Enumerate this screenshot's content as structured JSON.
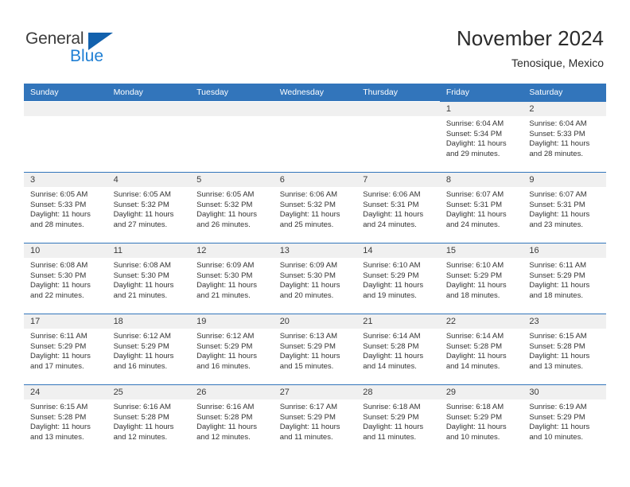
{
  "logo": {
    "word_top": "General",
    "word_bottom": "Blue",
    "triangle_color": "#1261ad",
    "blue_color": "#1f7fd4"
  },
  "header": {
    "title": "November 2024",
    "subtitle": "Tenosique, Mexico"
  },
  "theme": {
    "header_blue": "#3275bb",
    "daynum_gray": "#f0f0f0",
    "text": "#333333"
  },
  "weekdays": [
    "Sunday",
    "Monday",
    "Tuesday",
    "Wednesday",
    "Thursday",
    "Friday",
    "Saturday"
  ],
  "labels": {
    "sunrise_prefix": "Sunrise:",
    "sunset_prefix": "Sunset:",
    "daylight_prefix": "Daylight:"
  },
  "weeks": [
    [
      {
        "day": "",
        "sunrise": "",
        "sunset": "",
        "daylight1": "",
        "daylight2": ""
      },
      {
        "day": "",
        "sunrise": "",
        "sunset": "",
        "daylight1": "",
        "daylight2": ""
      },
      {
        "day": "",
        "sunrise": "",
        "sunset": "",
        "daylight1": "",
        "daylight2": ""
      },
      {
        "day": "",
        "sunrise": "",
        "sunset": "",
        "daylight1": "",
        "daylight2": ""
      },
      {
        "day": "",
        "sunrise": "",
        "sunset": "",
        "daylight1": "",
        "daylight2": ""
      },
      {
        "day": "1",
        "sunrise": "Sunrise: 6:04 AM",
        "sunset": "Sunset: 5:34 PM",
        "daylight1": "Daylight: 11 hours",
        "daylight2": "and 29 minutes."
      },
      {
        "day": "2",
        "sunrise": "Sunrise: 6:04 AM",
        "sunset": "Sunset: 5:33 PM",
        "daylight1": "Daylight: 11 hours",
        "daylight2": "and 28 minutes."
      }
    ],
    [
      {
        "day": "3",
        "sunrise": "Sunrise: 6:05 AM",
        "sunset": "Sunset: 5:33 PM",
        "daylight1": "Daylight: 11 hours",
        "daylight2": "and 28 minutes."
      },
      {
        "day": "4",
        "sunrise": "Sunrise: 6:05 AM",
        "sunset": "Sunset: 5:32 PM",
        "daylight1": "Daylight: 11 hours",
        "daylight2": "and 27 minutes."
      },
      {
        "day": "5",
        "sunrise": "Sunrise: 6:05 AM",
        "sunset": "Sunset: 5:32 PM",
        "daylight1": "Daylight: 11 hours",
        "daylight2": "and 26 minutes."
      },
      {
        "day": "6",
        "sunrise": "Sunrise: 6:06 AM",
        "sunset": "Sunset: 5:32 PM",
        "daylight1": "Daylight: 11 hours",
        "daylight2": "and 25 minutes."
      },
      {
        "day": "7",
        "sunrise": "Sunrise: 6:06 AM",
        "sunset": "Sunset: 5:31 PM",
        "daylight1": "Daylight: 11 hours",
        "daylight2": "and 24 minutes."
      },
      {
        "day": "8",
        "sunrise": "Sunrise: 6:07 AM",
        "sunset": "Sunset: 5:31 PM",
        "daylight1": "Daylight: 11 hours",
        "daylight2": "and 24 minutes."
      },
      {
        "day": "9",
        "sunrise": "Sunrise: 6:07 AM",
        "sunset": "Sunset: 5:31 PM",
        "daylight1": "Daylight: 11 hours",
        "daylight2": "and 23 minutes."
      }
    ],
    [
      {
        "day": "10",
        "sunrise": "Sunrise: 6:08 AM",
        "sunset": "Sunset: 5:30 PM",
        "daylight1": "Daylight: 11 hours",
        "daylight2": "and 22 minutes."
      },
      {
        "day": "11",
        "sunrise": "Sunrise: 6:08 AM",
        "sunset": "Sunset: 5:30 PM",
        "daylight1": "Daylight: 11 hours",
        "daylight2": "and 21 minutes."
      },
      {
        "day": "12",
        "sunrise": "Sunrise: 6:09 AM",
        "sunset": "Sunset: 5:30 PM",
        "daylight1": "Daylight: 11 hours",
        "daylight2": "and 21 minutes."
      },
      {
        "day": "13",
        "sunrise": "Sunrise: 6:09 AM",
        "sunset": "Sunset: 5:30 PM",
        "daylight1": "Daylight: 11 hours",
        "daylight2": "and 20 minutes."
      },
      {
        "day": "14",
        "sunrise": "Sunrise: 6:10 AM",
        "sunset": "Sunset: 5:29 PM",
        "daylight1": "Daylight: 11 hours",
        "daylight2": "and 19 minutes."
      },
      {
        "day": "15",
        "sunrise": "Sunrise: 6:10 AM",
        "sunset": "Sunset: 5:29 PM",
        "daylight1": "Daylight: 11 hours",
        "daylight2": "and 18 minutes."
      },
      {
        "day": "16",
        "sunrise": "Sunrise: 6:11 AM",
        "sunset": "Sunset: 5:29 PM",
        "daylight1": "Daylight: 11 hours",
        "daylight2": "and 18 minutes."
      }
    ],
    [
      {
        "day": "17",
        "sunrise": "Sunrise: 6:11 AM",
        "sunset": "Sunset: 5:29 PM",
        "daylight1": "Daylight: 11 hours",
        "daylight2": "and 17 minutes."
      },
      {
        "day": "18",
        "sunrise": "Sunrise: 6:12 AM",
        "sunset": "Sunset: 5:29 PM",
        "daylight1": "Daylight: 11 hours",
        "daylight2": "and 16 minutes."
      },
      {
        "day": "19",
        "sunrise": "Sunrise: 6:12 AM",
        "sunset": "Sunset: 5:29 PM",
        "daylight1": "Daylight: 11 hours",
        "daylight2": "and 16 minutes."
      },
      {
        "day": "20",
        "sunrise": "Sunrise: 6:13 AM",
        "sunset": "Sunset: 5:29 PM",
        "daylight1": "Daylight: 11 hours",
        "daylight2": "and 15 minutes."
      },
      {
        "day": "21",
        "sunrise": "Sunrise: 6:14 AM",
        "sunset": "Sunset: 5:28 PM",
        "daylight1": "Daylight: 11 hours",
        "daylight2": "and 14 minutes."
      },
      {
        "day": "22",
        "sunrise": "Sunrise: 6:14 AM",
        "sunset": "Sunset: 5:28 PM",
        "daylight1": "Daylight: 11 hours",
        "daylight2": "and 14 minutes."
      },
      {
        "day": "23",
        "sunrise": "Sunrise: 6:15 AM",
        "sunset": "Sunset: 5:28 PM",
        "daylight1": "Daylight: 11 hours",
        "daylight2": "and 13 minutes."
      }
    ],
    [
      {
        "day": "24",
        "sunrise": "Sunrise: 6:15 AM",
        "sunset": "Sunset: 5:28 PM",
        "daylight1": "Daylight: 11 hours",
        "daylight2": "and 13 minutes."
      },
      {
        "day": "25",
        "sunrise": "Sunrise: 6:16 AM",
        "sunset": "Sunset: 5:28 PM",
        "daylight1": "Daylight: 11 hours",
        "daylight2": "and 12 minutes."
      },
      {
        "day": "26",
        "sunrise": "Sunrise: 6:16 AM",
        "sunset": "Sunset: 5:28 PM",
        "daylight1": "Daylight: 11 hours",
        "daylight2": "and 12 minutes."
      },
      {
        "day": "27",
        "sunrise": "Sunrise: 6:17 AM",
        "sunset": "Sunset: 5:29 PM",
        "daylight1": "Daylight: 11 hours",
        "daylight2": "and 11 minutes."
      },
      {
        "day": "28",
        "sunrise": "Sunrise: 6:18 AM",
        "sunset": "Sunset: 5:29 PM",
        "daylight1": "Daylight: 11 hours",
        "daylight2": "and 11 minutes."
      },
      {
        "day": "29",
        "sunrise": "Sunrise: 6:18 AM",
        "sunset": "Sunset: 5:29 PM",
        "daylight1": "Daylight: 11 hours",
        "daylight2": "and 10 minutes."
      },
      {
        "day": "30",
        "sunrise": "Sunrise: 6:19 AM",
        "sunset": "Sunset: 5:29 PM",
        "daylight1": "Daylight: 11 hours",
        "daylight2": "and 10 minutes."
      }
    ]
  ]
}
